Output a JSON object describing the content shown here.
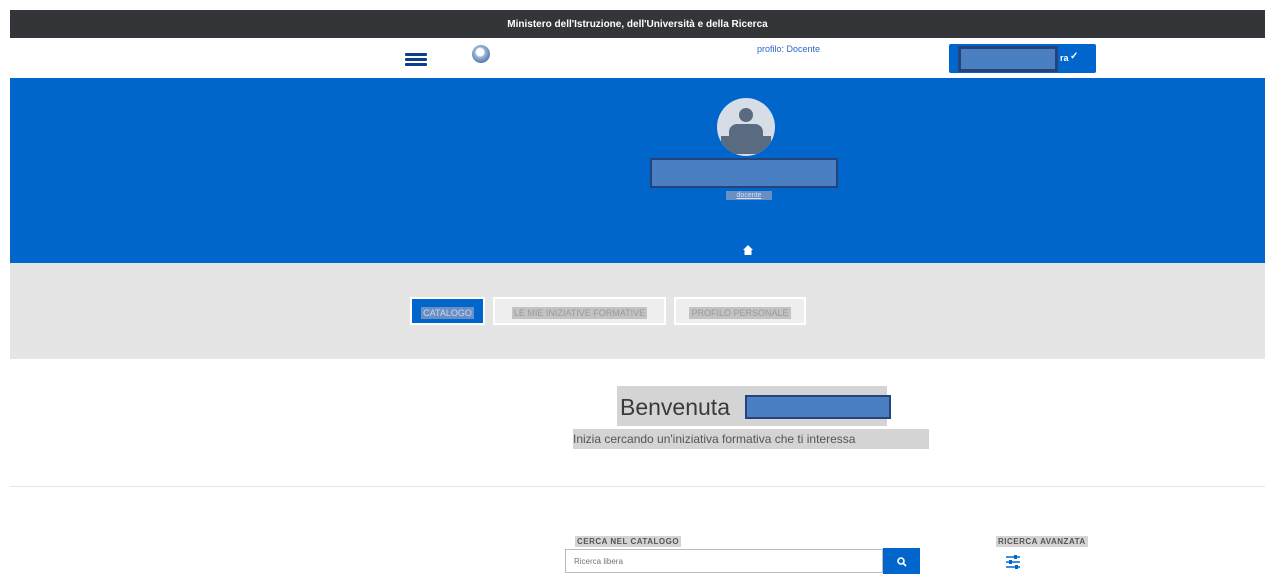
{
  "header": {
    "ministry_title": "Ministero dell'Istruzione, dell'Università e della Ricerca"
  },
  "nav": {
    "menu_icon": "hamburger-icon",
    "emblem_icon": "republic-emblem-icon",
    "profile_text": "profilo: Docente",
    "user_button_suffix": "ra",
    "user_button_chevron": "chevron-down-icon"
  },
  "hero": {
    "sub_label": "docente",
    "home_icon": "home-icon"
  },
  "tabs": [
    {
      "label": "CATALOGO",
      "active": true
    },
    {
      "label": "LE MIE INIZIATIVE FORMATIVE",
      "active": false
    },
    {
      "label": "PROFILO PERSONALE",
      "active": false
    }
  ],
  "welcome": {
    "greeting": "Benvenuta",
    "subtitle": "Inizia cercando un'iniziativa formativa che ti interessa"
  },
  "search": {
    "label": "CERCA NEL CATALOGO",
    "placeholder": "Ricerca libera",
    "button_icon": "search-icon",
    "advanced_label": "RICERCA AVANZATA",
    "advanced_icon": "sliders-icon"
  },
  "colors": {
    "primary": "#0066cc",
    "topbar": "#333538",
    "band": "#e5e5e5"
  }
}
